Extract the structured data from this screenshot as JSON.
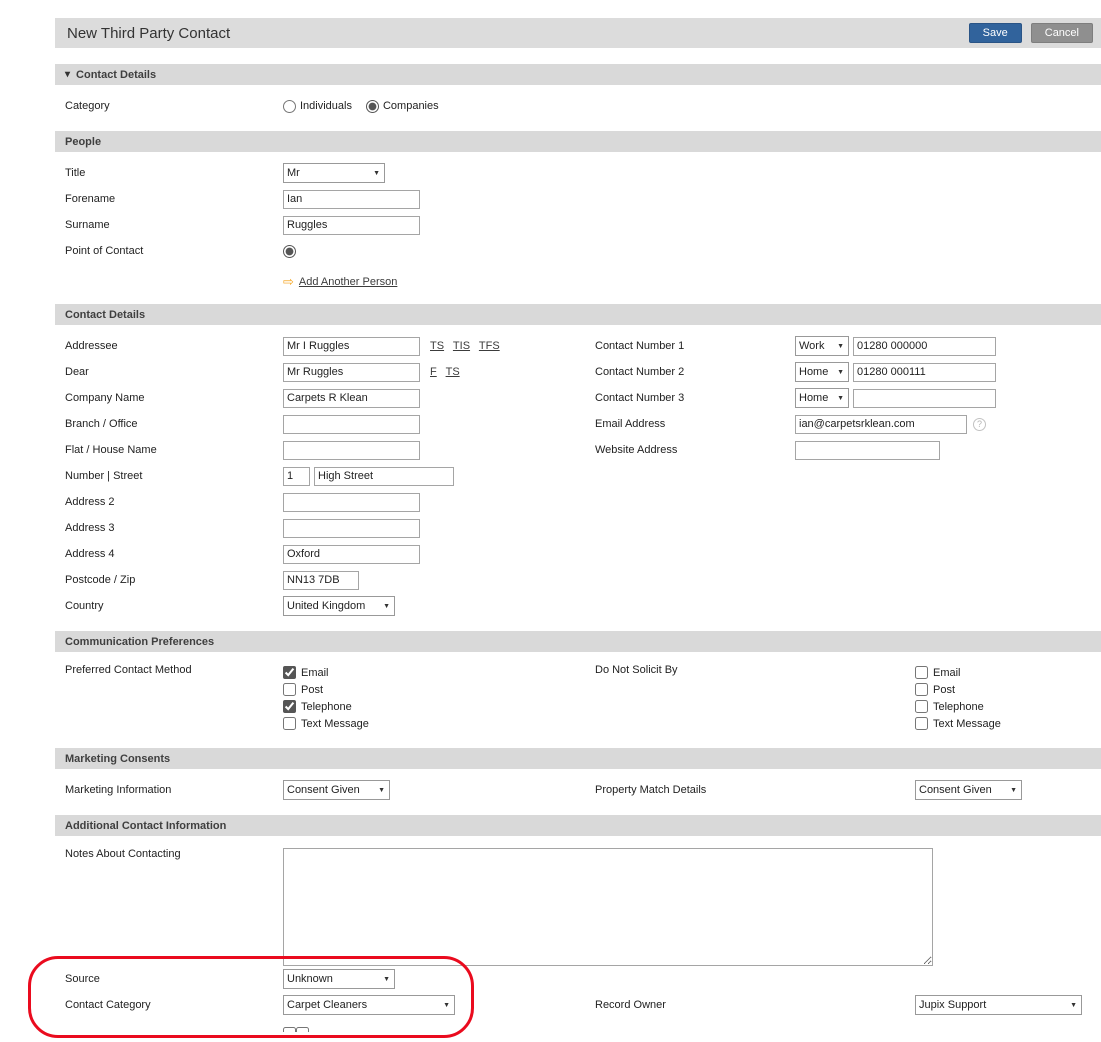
{
  "colors": {
    "save_button": "#31639c",
    "cancel_button": "#8f8f8f",
    "section_bar": "#d9d9d9",
    "annotation_red": "#ea0b1e"
  },
  "icons": {
    "collapse": "▾",
    "add_arrow": "⇨",
    "help": "?"
  },
  "header": {
    "title": "New Third Party Contact",
    "save": "Save",
    "cancel": "Cancel"
  },
  "sections": {
    "contact_details_top": "Contact Details",
    "people": "People",
    "contact_details": "Contact Details",
    "communication_preferences": "Communication Preferences",
    "marketing_consents": "Marketing Consents",
    "additional_contact_information": "Additional Contact Information"
  },
  "category": {
    "label": "Category",
    "individuals": "Individuals",
    "companies": "Companies",
    "individuals_checked": false,
    "companies_checked": true
  },
  "people": {
    "title_label": "Title",
    "title_value": "Mr",
    "forename_label": "Forename",
    "forename_value": "Ian",
    "surname_label": "Surname",
    "surname_value": "Ruggles",
    "point_of_contact_label": "Point of Contact",
    "point_of_contact_checked": true,
    "add_another_person": "Add Another Person"
  },
  "contact": {
    "addressee_label": "Addressee",
    "addressee_value": "Mr I Ruggles",
    "addressee_links": {
      "ts": "TS",
      "tis": "TIS",
      "tfs": "TFS"
    },
    "dear_label": "Dear",
    "dear_value": "Mr Ruggles",
    "dear_links": {
      "f": "F",
      "ts": "TS"
    },
    "company_name_label": "Company Name",
    "company_name_value": "Carpets R Klean",
    "branch_office_label": "Branch / Office",
    "branch_office_value": "",
    "flat_house_label": "Flat / House Name",
    "flat_house_value": "",
    "number_street_label": "Number | Street",
    "number_value": "1",
    "street_value": "High Street",
    "address2_label": "Address 2",
    "address2_value": "",
    "address3_label": "Address 3",
    "address3_value": "",
    "address4_label": "Address 4",
    "address4_value": "Oxford",
    "postcode_label": "Postcode / Zip",
    "postcode_value": "NN13 7DB",
    "country_label": "Country",
    "country_value": "United Kingdom",
    "number1_label": "Contact Number 1",
    "number1_type": "Work",
    "number1_value": "01280 000000",
    "number2_label": "Contact Number 2",
    "number2_type": "Home",
    "number2_value": "01280 000111",
    "number3_label": "Contact Number 3",
    "number3_type": "Home",
    "number3_value": "",
    "email_label": "Email Address",
    "email_value": "ian@carpetsrklean.com",
    "website_label": "Website Address",
    "website_value": ""
  },
  "communication": {
    "preferred_label": "Preferred Contact Method",
    "do_not_solicit_label": "Do Not Solicit By",
    "options": [
      "Email",
      "Post",
      "Telephone",
      "Text Message"
    ],
    "preferred_checked": [
      true,
      false,
      true,
      false
    ],
    "do_not_solicit_checked": [
      false,
      false,
      false,
      false
    ]
  },
  "marketing": {
    "marketing_information_label": "Marketing Information",
    "marketing_information_value": "Consent Given",
    "property_match_label": "Property Match Details",
    "property_match_value": "Consent Given"
  },
  "additional": {
    "notes_label": "Notes About Contacting",
    "notes_value": "",
    "source_label": "Source",
    "source_value": "Unknown",
    "contact_category_label": "Contact Category",
    "contact_category_value": "Carpet Cleaners",
    "record_owner_label": "Record Owner",
    "record_owner_value": "Jupix Support"
  }
}
